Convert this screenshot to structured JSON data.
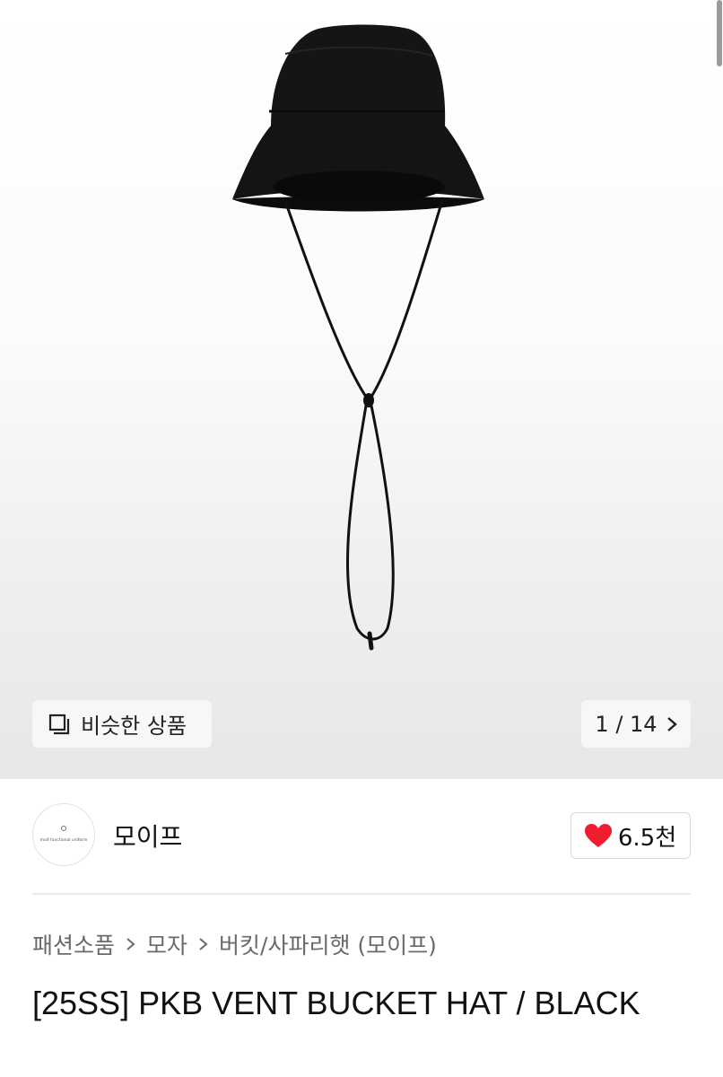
{
  "gallery": {
    "similar_label": "비슷한 상품",
    "counter": "1 / 14"
  },
  "seller": {
    "name": "모이프",
    "avatar_text": "moif functional uniform",
    "likes": "6.5천"
  },
  "breadcrumb": {
    "items": [
      "패션소품",
      "모자",
      "버킷/사파리햇 (모이프)"
    ]
  },
  "product": {
    "title": "[25SS] PKB VENT BUCKET HAT / BLACK"
  },
  "colors": {
    "heart": "#ee1d2f",
    "hat": "#151515"
  },
  "icons": [
    "similar-items-icon",
    "chevron-right-icon",
    "heart-icon"
  ]
}
